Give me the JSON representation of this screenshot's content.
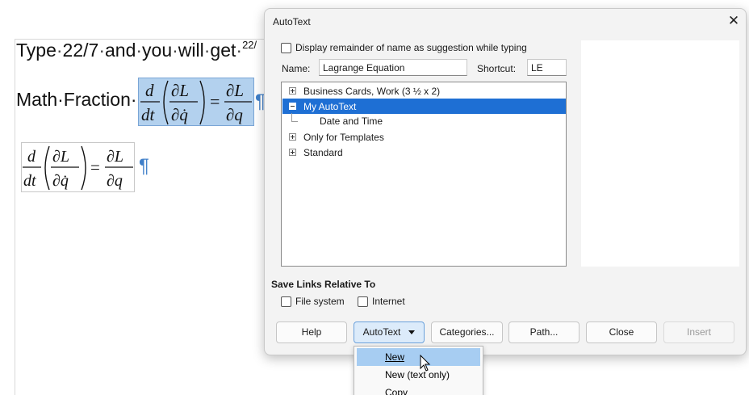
{
  "document": {
    "line1_words": [
      "Type",
      "22/7",
      "and",
      "you",
      "will",
      "get"
    ],
    "line1_sup": "22/",
    "line2_text": "Math·Fraction·",
    "formula": {
      "d": "d",
      "dt": "dt",
      "partial_L": "∂L",
      "partial_qdot": "∂q̇",
      "equals": "=",
      "partial_q": "∂q"
    },
    "pilcrow": "¶"
  },
  "dialog": {
    "title": "AutoText",
    "display_suggestion_label": "Display remainder of name as suggestion while typing",
    "display_suggestion_checked": false,
    "name_label": "Name:",
    "name_value": "Lagrange Equation",
    "shortcut_label": "Shortcut:",
    "shortcut_value": "LE",
    "tree": [
      {
        "label": "Business Cards, Work (3 ½ x 2)",
        "expanded": false,
        "selected": false
      },
      {
        "label": "My AutoText",
        "expanded": true,
        "selected": true
      },
      {
        "label": "Date and Time",
        "child": true
      },
      {
        "label": "Only for Templates",
        "expanded": false,
        "selected": false
      },
      {
        "label": "Standard",
        "expanded": false,
        "selected": false
      }
    ],
    "save_links_title": "Save Links Relative To",
    "file_system_label": "File system",
    "internet_label": "Internet",
    "buttons": {
      "help": "Help",
      "autotext": "AutoText",
      "categories": "Categories...",
      "path": "Path...",
      "close": "Close",
      "insert": "Insert"
    }
  },
  "menu": {
    "items": [
      "New",
      "New (text only)",
      "Copy"
    ],
    "highlighted": "New"
  },
  "colors": {
    "selection": "#1e6fd4",
    "menu_highlight": "#a7cdf2",
    "formula_highlight": "#b3d1ee",
    "pilcrow": "#3f7fc9"
  }
}
